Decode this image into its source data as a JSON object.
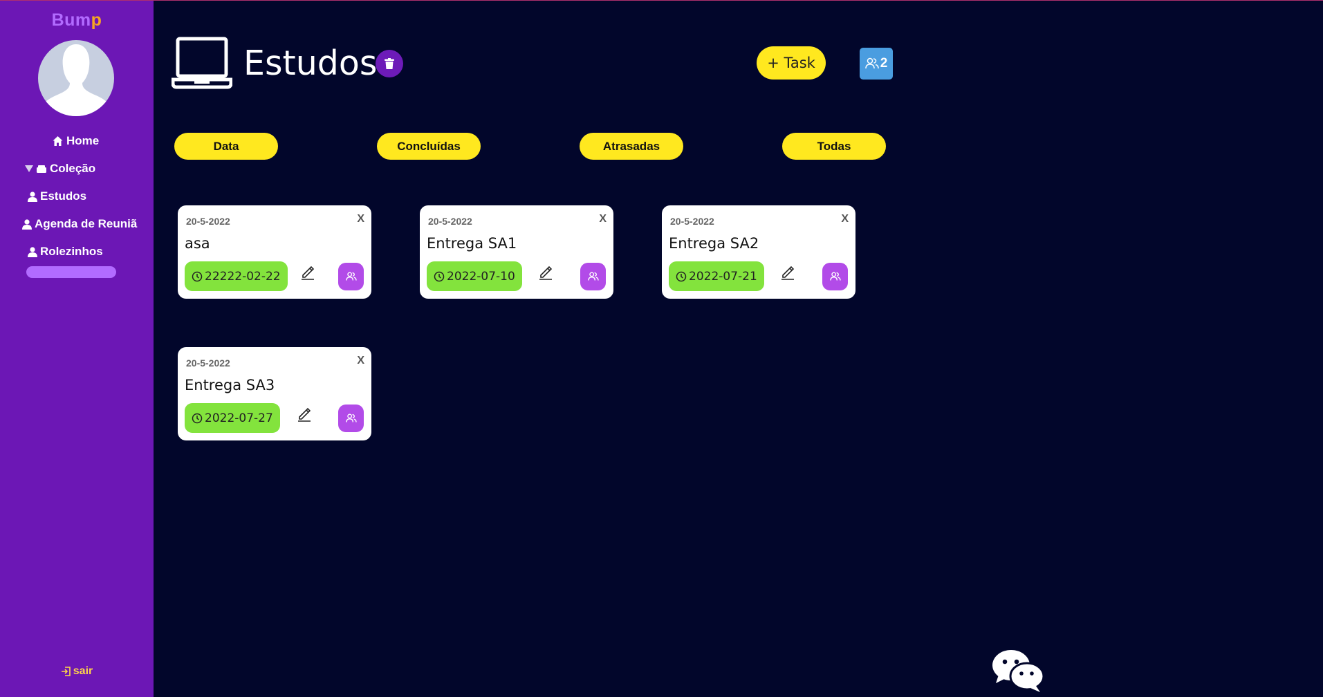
{
  "brand": {
    "part1": "Bum",
    "part2": "p"
  },
  "sidebar": {
    "items": [
      {
        "label": "Home",
        "icon": "home-icon"
      },
      {
        "label": "Coleção",
        "icon": "folder-icon"
      },
      {
        "label": "Estudos",
        "icon": "user-icon"
      },
      {
        "label": "Agenda de Reuniã",
        "icon": "user-icon"
      },
      {
        "label": "Rolezinhos",
        "icon": "user-icon"
      }
    ],
    "logout_label": "sair"
  },
  "header": {
    "title": "Estudos",
    "add_task_label": "+ Task",
    "members_count": "2"
  },
  "filters": [
    "Data",
    "Concluídas",
    "Atrasadas",
    "Todas"
  ],
  "cards": [
    {
      "date": "20-5-2022",
      "close": "X",
      "title": "asa",
      "deadline": "22222-02-22"
    },
    {
      "date": "20-5-2022",
      "close": "X",
      "title": "Entrega SA1",
      "deadline": "2022-07-10"
    },
    {
      "date": "20-5-2022",
      "close": "X",
      "title": "Entrega SA2",
      "deadline": "2022-07-21"
    },
    {
      "date": "20-5-2022",
      "close": "X",
      "title": "Entrega SA3",
      "deadline": "2022-07-27"
    }
  ],
  "colors": {
    "background": "#02062b",
    "sidebar": "#6c17b5",
    "accent_yellow": "#ffe81f",
    "deadline_green": "#83e33d",
    "assign_purple": "#b24be8",
    "members_blue": "#4a9de0"
  }
}
